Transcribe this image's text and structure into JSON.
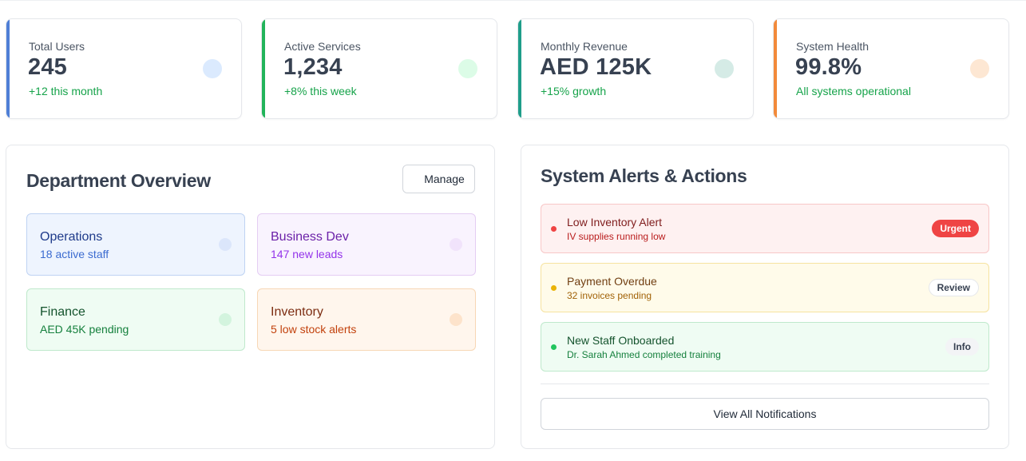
{
  "stats": [
    {
      "label": "Total Users",
      "value": "245",
      "sub": "+12 this month",
      "accent": "#4f7fd6",
      "dot": "#dbeafe"
    },
    {
      "label": "Active Services",
      "value": "1,234",
      "sub": "+8% this week",
      "accent": "#22b45a",
      "dot": "#dcfce7"
    },
    {
      "label": "Monthly Revenue",
      "value": "AED 125K",
      "sub": "+15% growth",
      "accent": "#1f9e8a",
      "dot": "#d5ebe6"
    },
    {
      "label": "System Health",
      "value": "99.8%",
      "sub": "All systems operational",
      "accent": "#f28a3a",
      "dot": "#fde7d3"
    }
  ],
  "departments": {
    "title": "Department Overview",
    "manage_label": "Manage",
    "items": [
      {
        "name": "Operations",
        "sub": "18 active staff"
      },
      {
        "name": "Business Dev",
        "sub": "147 new leads"
      },
      {
        "name": "Finance",
        "sub": "AED 45K pending"
      },
      {
        "name": "Inventory",
        "sub": "5 low stock alerts"
      }
    ]
  },
  "alerts": {
    "title": "System Alerts & Actions",
    "items": [
      {
        "title": "Low Inventory Alert",
        "sub": "IV supplies running low",
        "badge": "Urgent"
      },
      {
        "title": "Payment Overdue",
        "sub": "32 invoices pending",
        "badge": "Review"
      },
      {
        "title": "New Staff Onboarded",
        "sub": "Dr. Sarah Ahmed completed training",
        "badge": "Info"
      }
    ],
    "view_all_label": "View All Notifications"
  }
}
